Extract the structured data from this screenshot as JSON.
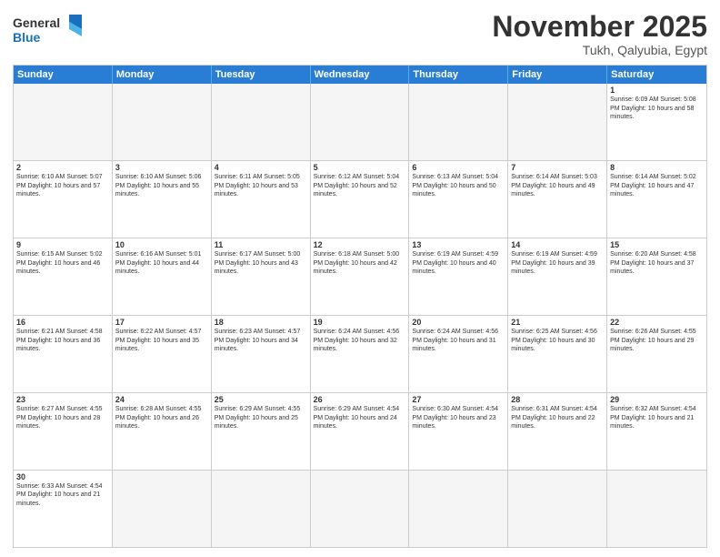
{
  "logo": {
    "general": "General",
    "blue": "Blue"
  },
  "title": "November 2025",
  "location": "Tukh, Qalyubia, Egypt",
  "days_of_week": [
    "Sunday",
    "Monday",
    "Tuesday",
    "Wednesday",
    "Thursday",
    "Friday",
    "Saturday"
  ],
  "weeks": [
    [
      {
        "day": "",
        "empty": true
      },
      {
        "day": "",
        "empty": true
      },
      {
        "day": "",
        "empty": true
      },
      {
        "day": "",
        "empty": true
      },
      {
        "day": "",
        "empty": true
      },
      {
        "day": "",
        "empty": true
      },
      {
        "day": "1",
        "info": "Sunrise: 6:09 AM\nSunset: 5:08 PM\nDaylight: 10 hours\nand 58 minutes."
      }
    ],
    [
      {
        "day": "2",
        "info": "Sunrise: 6:10 AM\nSunset: 5:07 PM\nDaylight: 10 hours\nand 57 minutes."
      },
      {
        "day": "3",
        "info": "Sunrise: 6:10 AM\nSunset: 5:06 PM\nDaylight: 10 hours\nand 55 minutes."
      },
      {
        "day": "4",
        "info": "Sunrise: 6:11 AM\nSunset: 5:05 PM\nDaylight: 10 hours\nand 53 minutes."
      },
      {
        "day": "5",
        "info": "Sunrise: 6:12 AM\nSunset: 5:04 PM\nDaylight: 10 hours\nand 52 minutes."
      },
      {
        "day": "6",
        "info": "Sunrise: 6:13 AM\nSunset: 5:04 PM\nDaylight: 10 hours\nand 50 minutes."
      },
      {
        "day": "7",
        "info": "Sunrise: 6:14 AM\nSunset: 5:03 PM\nDaylight: 10 hours\nand 49 minutes."
      },
      {
        "day": "8",
        "info": "Sunrise: 6:14 AM\nSunset: 5:02 PM\nDaylight: 10 hours\nand 47 minutes."
      }
    ],
    [
      {
        "day": "9",
        "info": "Sunrise: 6:15 AM\nSunset: 5:02 PM\nDaylight: 10 hours\nand 46 minutes."
      },
      {
        "day": "10",
        "info": "Sunrise: 6:16 AM\nSunset: 5:01 PM\nDaylight: 10 hours\nand 44 minutes."
      },
      {
        "day": "11",
        "info": "Sunrise: 6:17 AM\nSunset: 5:00 PM\nDaylight: 10 hours\nand 43 minutes."
      },
      {
        "day": "12",
        "info": "Sunrise: 6:18 AM\nSunset: 5:00 PM\nDaylight: 10 hours\nand 42 minutes."
      },
      {
        "day": "13",
        "info": "Sunrise: 6:19 AM\nSunset: 4:59 PM\nDaylight: 10 hours\nand 40 minutes."
      },
      {
        "day": "14",
        "info": "Sunrise: 6:19 AM\nSunset: 4:59 PM\nDaylight: 10 hours\nand 39 minutes."
      },
      {
        "day": "15",
        "info": "Sunrise: 6:20 AM\nSunset: 4:58 PM\nDaylight: 10 hours\nand 37 minutes."
      }
    ],
    [
      {
        "day": "16",
        "info": "Sunrise: 6:21 AM\nSunset: 4:58 PM\nDaylight: 10 hours\nand 36 minutes."
      },
      {
        "day": "17",
        "info": "Sunrise: 6:22 AM\nSunset: 4:57 PM\nDaylight: 10 hours\nand 35 minutes."
      },
      {
        "day": "18",
        "info": "Sunrise: 6:23 AM\nSunset: 4:57 PM\nDaylight: 10 hours\nand 34 minutes."
      },
      {
        "day": "19",
        "info": "Sunrise: 6:24 AM\nSunset: 4:56 PM\nDaylight: 10 hours\nand 32 minutes."
      },
      {
        "day": "20",
        "info": "Sunrise: 6:24 AM\nSunset: 4:56 PM\nDaylight: 10 hours\nand 31 minutes."
      },
      {
        "day": "21",
        "info": "Sunrise: 6:25 AM\nSunset: 4:56 PM\nDaylight: 10 hours\nand 30 minutes."
      },
      {
        "day": "22",
        "info": "Sunrise: 6:26 AM\nSunset: 4:55 PM\nDaylight: 10 hours\nand 29 minutes."
      }
    ],
    [
      {
        "day": "23",
        "info": "Sunrise: 6:27 AM\nSunset: 4:55 PM\nDaylight: 10 hours\nand 28 minutes."
      },
      {
        "day": "24",
        "info": "Sunrise: 6:28 AM\nSunset: 4:55 PM\nDaylight: 10 hours\nand 26 minutes."
      },
      {
        "day": "25",
        "info": "Sunrise: 6:29 AM\nSunset: 4:55 PM\nDaylight: 10 hours\nand 25 minutes."
      },
      {
        "day": "26",
        "info": "Sunrise: 6:29 AM\nSunset: 4:54 PM\nDaylight: 10 hours\nand 24 minutes."
      },
      {
        "day": "27",
        "info": "Sunrise: 6:30 AM\nSunset: 4:54 PM\nDaylight: 10 hours\nand 23 minutes."
      },
      {
        "day": "28",
        "info": "Sunrise: 6:31 AM\nSunset: 4:54 PM\nDaylight: 10 hours\nand 22 minutes."
      },
      {
        "day": "29",
        "info": "Sunrise: 6:32 AM\nSunset: 4:54 PM\nDaylight: 10 hours\nand 21 minutes."
      }
    ],
    [
      {
        "day": "30",
        "info": "Sunrise: 6:33 AM\nSunset: 4:54 PM\nDaylight: 10 hours\nand 21 minutes."
      },
      {
        "day": "",
        "empty": true
      },
      {
        "day": "",
        "empty": true
      },
      {
        "day": "",
        "empty": true
      },
      {
        "day": "",
        "empty": true
      },
      {
        "day": "",
        "empty": true
      },
      {
        "day": "",
        "empty": true
      }
    ]
  ]
}
